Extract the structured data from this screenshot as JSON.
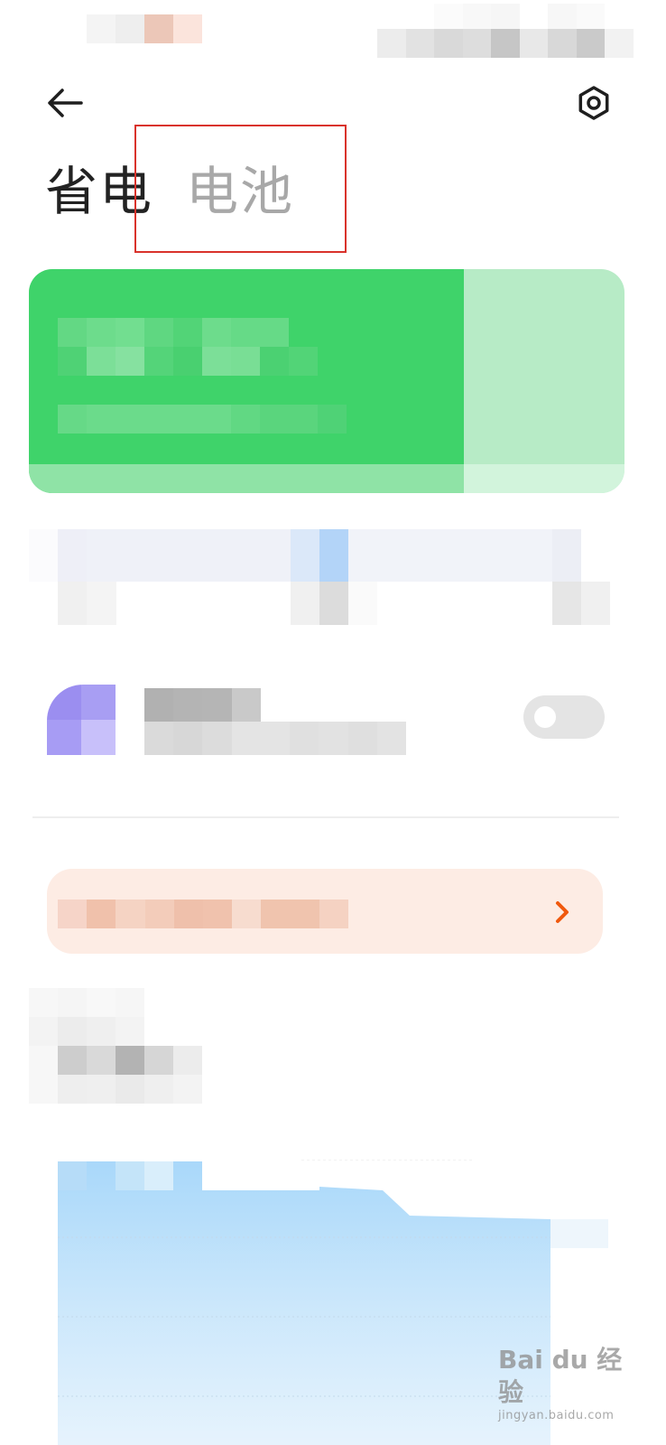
{
  "header": {
    "tabs": [
      {
        "label": "省电",
        "active": true
      },
      {
        "label": "电池",
        "active": false
      }
    ]
  },
  "watermark": {
    "logo_text": "Bai du 经验",
    "url": "jingyan.baidu.com"
  },
  "colors": {
    "battery_card": "#3fd36a",
    "tip_accent": "#f0590e",
    "chart_fill": "#b9e1fb",
    "highlight_box": "#d9322b"
  },
  "icons": {
    "back": "arrow-left-icon",
    "settings": "gear-icon",
    "chevron": "chevron-right-icon"
  }
}
